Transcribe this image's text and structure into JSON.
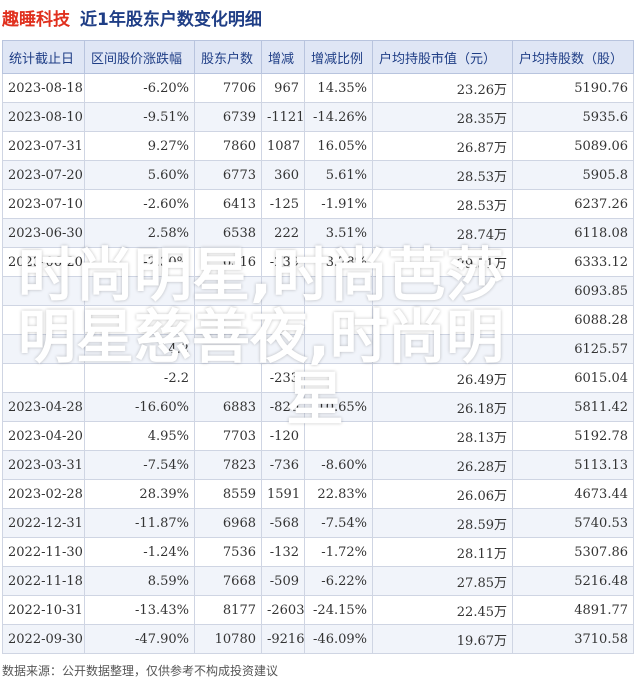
{
  "header": {
    "stock_name": "趣睡科技",
    "table_title": "近1年股东户数变化明细"
  },
  "table": {
    "columns": [
      "统计截止日",
      "区间股价涨跌幅",
      "股东户数",
      "增减",
      "增减比例",
      "户均持股市值（元）",
      "户均持股数（股）"
    ],
    "rows": [
      {
        "date": "2023-08-18",
        "pct": "-6.20%",
        "holders": "7706",
        "change": "967",
        "ratio": "14.35%",
        "value": "23.26万",
        "shares": "5190.76",
        "pct_dir": "down",
        "chg_dir": "up"
      },
      {
        "date": "2023-08-10",
        "pct": "-9.51%",
        "holders": "6739",
        "change": "-1121",
        "ratio": "-14.26%",
        "value": "28.35万",
        "shares": "5935.6",
        "pct_dir": "down",
        "chg_dir": "down"
      },
      {
        "date": "2023-07-31",
        "pct": "9.27%",
        "holders": "7860",
        "change": "1087",
        "ratio": "16.05%",
        "value": "26.87万",
        "shares": "5089.06",
        "pct_dir": "up",
        "chg_dir": "up"
      },
      {
        "date": "2023-07-20",
        "pct": "5.60%",
        "holders": "6773",
        "change": "360",
        "ratio": "5.61%",
        "value": "28.53万",
        "shares": "5905.8",
        "pct_dir": "up",
        "chg_dir": "up"
      },
      {
        "date": "2023-07-10",
        "pct": "-2.60%",
        "holders": "6413",
        "change": "-125",
        "ratio": "-1.91%",
        "value": "28.53万",
        "shares": "6237.26",
        "pct_dir": "down",
        "chg_dir": "down"
      },
      {
        "date": "2023-06-30",
        "pct": "2.58%",
        "holders": "6538",
        "change": "222",
        "ratio": "3.51%",
        "value": "28.74万",
        "shares": "6118.08",
        "pct_dir": "up",
        "chg_dir": "up"
      },
      {
        "date": "2023-06-20",
        "pct": "-2.30%",
        "holders": "6316",
        "change": "-239",
        "ratio": "3.78%",
        "value": "29.51万",
        "shares": "6333.12",
        "pct_dir": "down",
        "chg_dir": "up"
      },
      {
        "date": "",
        "pct": "",
        "holders": "",
        "change": "",
        "ratio": "",
        "value": "",
        "shares": "6093.85",
        "pct_dir": "down",
        "chg_dir": "down"
      },
      {
        "date": "",
        "pct": "",
        "holders": "",
        "change": "",
        "ratio": "",
        "value": "",
        "shares": "6088.28",
        "pct_dir": "down",
        "chg_dir": "down"
      },
      {
        "date": "",
        "pct": "4.2",
        "holders": "",
        "change": "",
        "ratio": "",
        "value": "",
        "shares": "6125.57",
        "pct_dir": "up",
        "chg_dir": "up"
      },
      {
        "date": "",
        "pct": "-2.2",
        "holders": "",
        "change": "-233",
        "ratio": "",
        "value": "26.49万",
        "shares": "6015.04",
        "pct_dir": "down",
        "chg_dir": "down"
      },
      {
        "date": "2023-04-28",
        "pct": "-16.60%",
        "holders": "6883",
        "change": "-820",
        "ratio": "-10.65%",
        "value": "26.18万",
        "shares": "5811.42",
        "pct_dir": "down",
        "chg_dir": "down"
      },
      {
        "date": "2023-04-20",
        "pct": "4.95%",
        "holders": "7703",
        "change": "-120",
        "ratio": "",
        "value": "28.13万",
        "shares": "5192.78",
        "pct_dir": "up",
        "chg_dir": "down"
      },
      {
        "date": "2023-03-31",
        "pct": "-7.54%",
        "holders": "7823",
        "change": "-736",
        "ratio": "-8.60%",
        "value": "26.28万",
        "shares": "5113.13",
        "pct_dir": "down",
        "chg_dir": "down"
      },
      {
        "date": "2023-02-28",
        "pct": "28.39%",
        "holders": "8559",
        "change": "1591",
        "ratio": "22.83%",
        "value": "26.06万",
        "shares": "4673.44",
        "pct_dir": "up",
        "chg_dir": "up"
      },
      {
        "date": "2022-12-31",
        "pct": "-11.87%",
        "holders": "6968",
        "change": "-568",
        "ratio": "-7.54%",
        "value": "28.59万",
        "shares": "5740.53",
        "pct_dir": "down",
        "chg_dir": "down"
      },
      {
        "date": "2022-11-30",
        "pct": "-1.24%",
        "holders": "7536",
        "change": "-132",
        "ratio": "-1.72%",
        "value": "28.11万",
        "shares": "5307.86",
        "pct_dir": "down",
        "chg_dir": "down"
      },
      {
        "date": "2022-11-18",
        "pct": "8.59%",
        "holders": "7668",
        "change": "-509",
        "ratio": "-6.22%",
        "value": "27.85万",
        "shares": "5216.48",
        "pct_dir": "up",
        "chg_dir": "down"
      },
      {
        "date": "2022-10-31",
        "pct": "-13.43%",
        "holders": "8177",
        "change": "-2603",
        "ratio": "-24.15%",
        "value": "22.45万",
        "shares": "4891.77",
        "pct_dir": "down",
        "chg_dir": "down"
      },
      {
        "date": "2022-09-30",
        "pct": "-47.90%",
        "holders": "10780",
        "change": "-9216",
        "ratio": "-46.09%",
        "value": "19.67万",
        "shares": "3710.58",
        "pct_dir": "down",
        "chg_dir": "down"
      }
    ]
  },
  "overlay_text": {
    "line1": "时尚明星,时尚芭莎",
    "line2": "明星慈善夜,时尚明",
    "line3": "星"
  },
  "footer": {
    "source": "数据来源：公开数据整理，仅供参考不构成投资建议"
  },
  "colors": {
    "up": "#e0301e",
    "down": "#1a9e3f",
    "header_bg": "#dfe6f5",
    "title_blue": "#1f3e86"
  }
}
